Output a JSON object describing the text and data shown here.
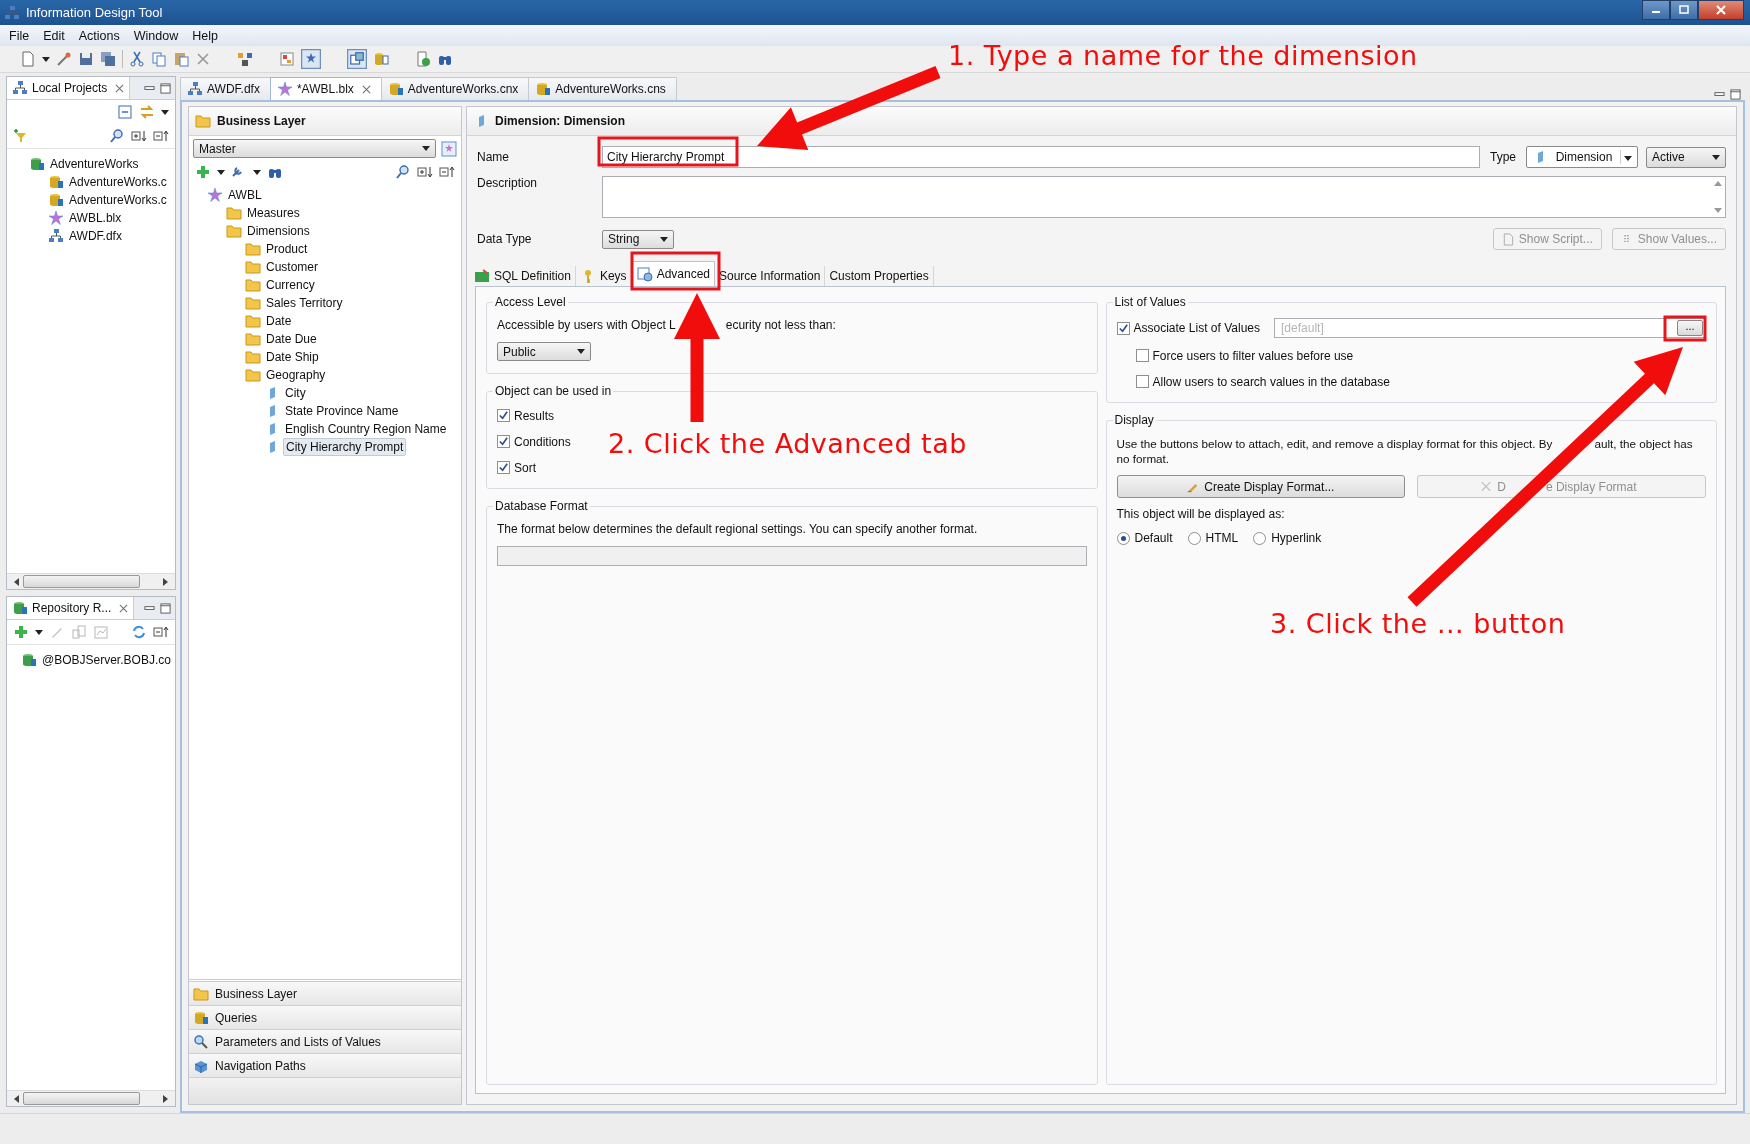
{
  "window": {
    "title": "Information Design Tool"
  },
  "menu": [
    "File",
    "Edit",
    "Actions",
    "Window",
    "Help"
  ],
  "local_projects": {
    "title": "Local Projects",
    "tree": [
      {
        "label": "AdventureWorks",
        "kind": "project",
        "children": [
          {
            "label": "AdventureWorks.c",
            "kind": "connection"
          },
          {
            "label": "AdventureWorks.c",
            "kind": "connection"
          },
          {
            "label": "AWBL.blx",
            "kind": "business-layer"
          },
          {
            "label": "AWDF.dfx",
            "kind": "foundation"
          }
        ]
      }
    ]
  },
  "repository": {
    "title": "Repository R...",
    "items": [
      {
        "label": "@BOBJServer.BOBJ.co",
        "kind": "server"
      }
    ]
  },
  "editor_tabs": [
    {
      "label": "AWDF.dfx",
      "kind": "foundation",
      "selected": false
    },
    {
      "label": "*AWBL.blx",
      "kind": "business-layer",
      "selected": true
    },
    {
      "label": "AdventureWorks.cnx",
      "kind": "connection",
      "selected": false
    },
    {
      "label": "AdventureWorks.cns",
      "kind": "connection",
      "selected": false
    }
  ],
  "business_layer": {
    "title": "Business Layer",
    "view": "Master",
    "tree": [
      {
        "label": "AWBL",
        "kind": "business-layer",
        "selected": false,
        "children": [
          {
            "label": "Measures",
            "kind": "folder",
            "selected": false
          },
          {
            "label": "Dimensions",
            "kind": "folder",
            "selected": false,
            "children": [
              {
                "label": "Product",
                "kind": "folder",
                "selected": false
              },
              {
                "label": "Customer",
                "kind": "folder",
                "selected": false
              },
              {
                "label": "Currency",
                "kind": "folder",
                "selected": false
              },
              {
                "label": "Sales Territory",
                "kind": "folder",
                "selected": false
              },
              {
                "label": "Date",
                "kind": "folder",
                "selected": false
              },
              {
                "label": "Date Due",
                "kind": "folder",
                "selected": false
              },
              {
                "label": "Date Ship",
                "kind": "folder",
                "selected": false
              },
              {
                "label": "Geography",
                "kind": "folder",
                "selected": false,
                "children": [
                  {
                    "label": "City",
                    "kind": "dimension",
                    "selected": false
                  },
                  {
                    "label": "State Province Name",
                    "kind": "dimension",
                    "selected": false
                  },
                  {
                    "label": "English Country Region Name",
                    "kind": "dimension",
                    "selected": false
                  },
                  {
                    "label": "City Hierarchy Prompt",
                    "kind": "dimension",
                    "selected": true
                  }
                ]
              }
            ]
          }
        ]
      }
    ],
    "sections": [
      {
        "label": "Business Layer",
        "kind": "folder"
      },
      {
        "label": "Queries",
        "kind": "query"
      },
      {
        "label": "Parameters and Lists of Values",
        "kind": "parameter"
      },
      {
        "label": "Navigation Paths",
        "kind": "navigation"
      }
    ]
  },
  "dimension": {
    "title": "Dimension: Dimension",
    "name_label": "Name",
    "name": "City Hierarchy Prompt",
    "type_label": "Type",
    "type": "Dimension",
    "status": "Active",
    "description_label": "Description",
    "data_type_label": "Data Type",
    "data_type": "String",
    "buttons": [
      {
        "label": "Show Script...",
        "kind": "script",
        "disabled": true
      },
      {
        "label": "Show Values...",
        "kind": "values",
        "disabled": true
      }
    ],
    "tabs": [
      {
        "label": "SQL Definition",
        "kind": "sql",
        "selected": false
      },
      {
        "label": "Keys",
        "kind": "key",
        "selected": false
      },
      {
        "label": "Advanced",
        "kind": "advanced",
        "selected": true
      },
      {
        "label": "Source Information",
        "kind": "none",
        "selected": false
      },
      {
        "label": "Custom Properties",
        "kind": "none",
        "selected": false
      }
    ]
  },
  "advanced": {
    "access_level": {
      "title": "Access Level",
      "text_parts": [
        "Accessible by users with Object L",
        "ecurity not less than:"
      ],
      "value": "Public"
    },
    "usage": {
      "title": "Object can be used in",
      "options": [
        {
          "label": "Results",
          "checked": true
        },
        {
          "label": "Conditions",
          "checked": true
        },
        {
          "label": "Sort",
          "checked": true
        }
      ]
    },
    "database_format": {
      "title": "Database Format",
      "text": "The format below determines the default regional settings. You can specify another format."
    },
    "list_of_values": {
      "title": "List of Values",
      "associate": {
        "label": "Associate List of Values",
        "checked": true
      },
      "placeholder": "[default]",
      "browse": "...",
      "options": [
        {
          "label": "Force users to filter values before use",
          "checked": false
        },
        {
          "label": "Allow users to search values in the database",
          "checked": false
        }
      ]
    },
    "display": {
      "title": "Display",
      "text_parts": [
        "Use the buttons below to attach, edit, and remove a display format for this object. By",
        "ault, the object has",
        "no format."
      ],
      "buttons": [
        {
          "label_parts": [
            "Create Display Format..."
          ],
          "kind": "pencil",
          "disabled": false
        },
        {
          "label_parts": [
            "D",
            "e Display Format"
          ],
          "kind": "cross",
          "disabled": true
        }
      ],
      "displayed_as": "This object will be displayed as:",
      "options": [
        {
          "label": "Default",
          "selected": true
        },
        {
          "label": "HTML",
          "selected": false
        },
        {
          "label": "Hyperlink",
          "selected": false
        }
      ]
    }
  },
  "annotations": [
    {
      "text": "1. Type a name for the dimension"
    },
    {
      "text": "2. Click the Advanced tab"
    },
    {
      "text": "3. Click the … button"
    }
  ]
}
